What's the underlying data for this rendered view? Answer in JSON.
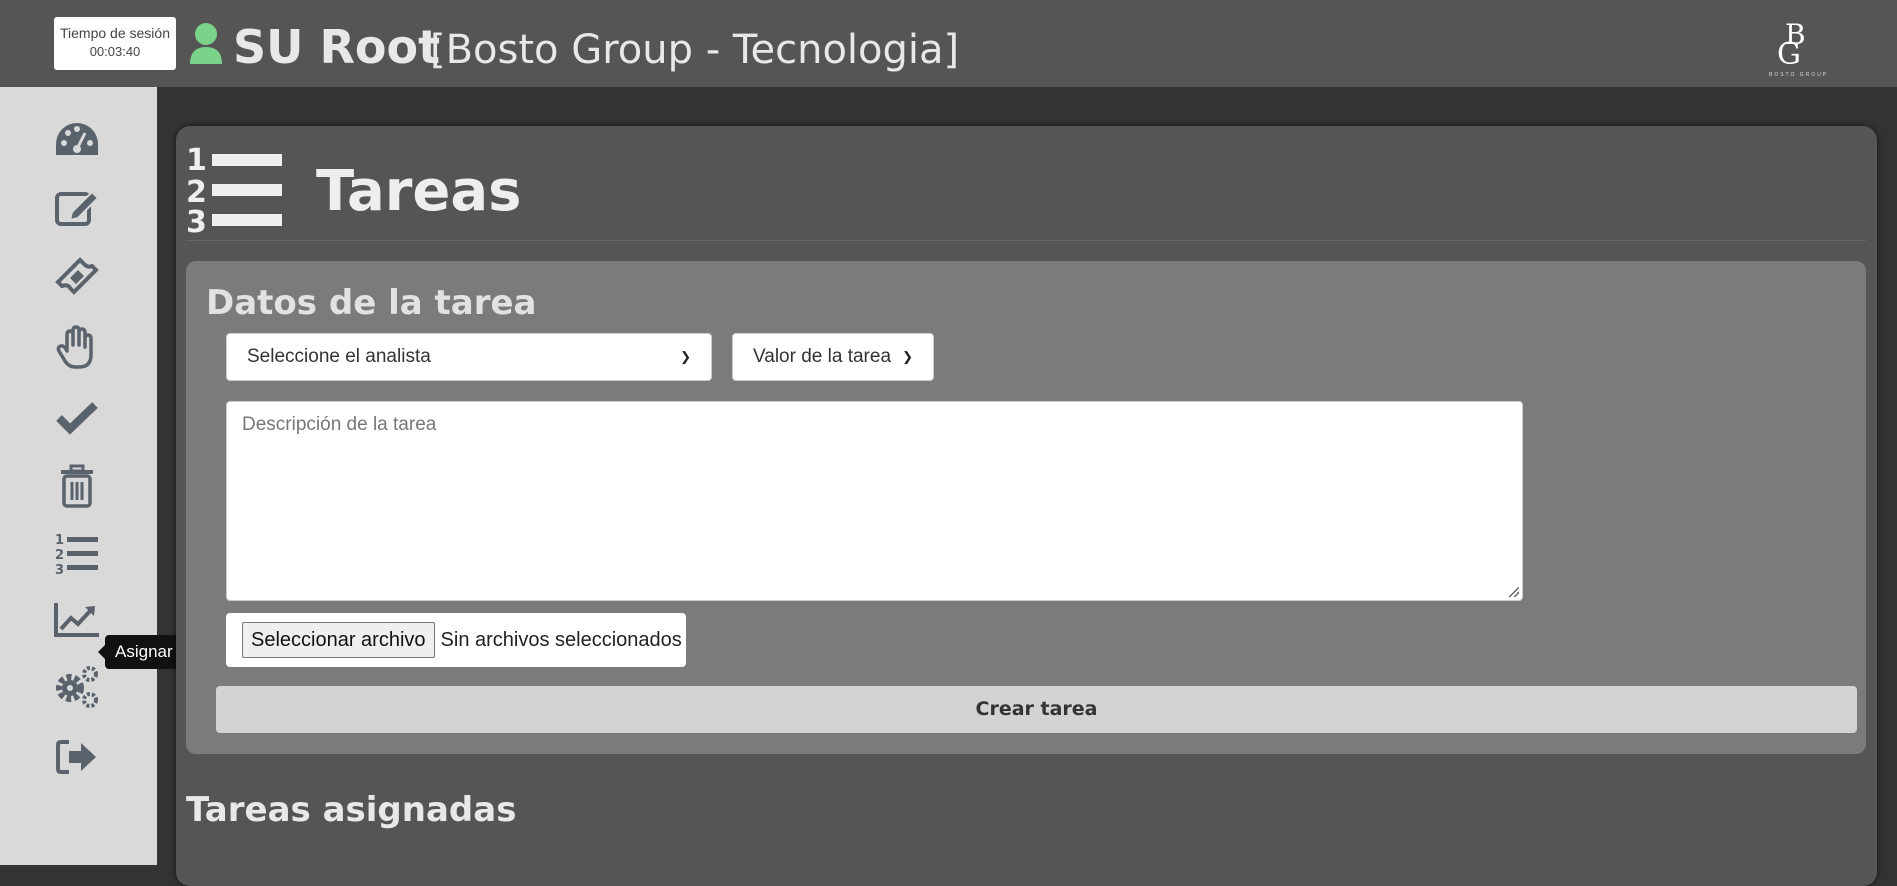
{
  "header": {
    "session_label": "Tiempo de sesión",
    "session_time": "00:03:40",
    "user_name": "SU Root",
    "organization": "[Bosto Group - Tecnologia]",
    "logo_text": "BOSTO GROUP"
  },
  "sidebar": {
    "items": [
      {
        "icon": "dashboard-gauge-icon"
      },
      {
        "icon": "edit-icon"
      },
      {
        "icon": "ticket-icon"
      },
      {
        "icon": "hand-icon"
      },
      {
        "icon": "check-icon"
      },
      {
        "icon": "trash-icon"
      },
      {
        "icon": "ordered-list-icon",
        "tooltip": "Asignar tareas"
      },
      {
        "icon": "chart-line-icon"
      },
      {
        "icon": "settings-gears-icon"
      },
      {
        "icon": "logout-icon"
      }
    ]
  },
  "page": {
    "title": "Tareas"
  },
  "form": {
    "section_title": "Datos de la tarea",
    "analyst_select": "Seleccione el analista",
    "value_select": "Valor de la tarea",
    "description_placeholder": "Descripción de la tarea",
    "file_button": "Seleccionar archivo",
    "file_status": "Sin archivos seleccionados",
    "create_button": "Crear tarea"
  },
  "assigned": {
    "section_title": "Tareas asignadas"
  },
  "colors": {
    "user_icon": "#7bd389",
    "sidebar_icons": "#5a626b",
    "panel": "#555555",
    "card": "#7b7b7b"
  }
}
